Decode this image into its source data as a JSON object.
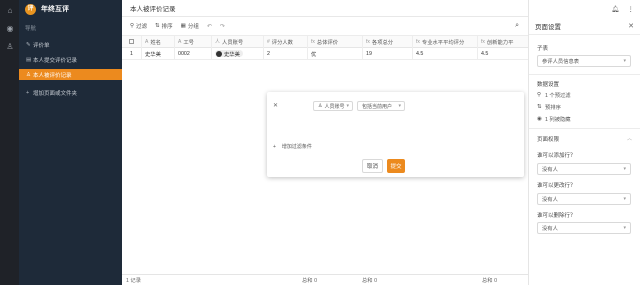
{
  "app": {
    "name": "年终互评",
    "logo_char": "评"
  },
  "rail": {
    "icons": [
      "home-icon",
      "eye-icon",
      "user-settings-icon"
    ]
  },
  "sidebar": {
    "section": "导航",
    "items": [
      {
        "label": "评价单",
        "icon": "edit-icon"
      },
      {
        "label": "本人提交评价记录",
        "icon": "list-icon"
      },
      {
        "label": "本人被评价记录",
        "icon": "user-icon",
        "active": true
      },
      {
        "label": "增加页面或文件夹",
        "icon": "plus-icon"
      }
    ]
  },
  "header": {
    "title": "本人被评价记录"
  },
  "toolbar": {
    "filter": "过滤",
    "sort": "排序",
    "group": "分组"
  },
  "table": {
    "columns": [
      "姓名",
      "工号",
      "人员账号",
      "评分人数",
      "总体评价",
      "各项总分",
      "专业水平平均评分",
      "创新能力平"
    ],
    "column_icons": [
      "A",
      "A",
      "人",
      "#",
      "fx",
      "fx",
      "fx",
      "fx"
    ],
    "rows": [
      {
        "index": "1",
        "name": "史华美",
        "id": "0002",
        "account": "史华美",
        "count": "2",
        "overall": "优",
        "total": "19",
        "pro": "4.5",
        "innov": "4.5"
      }
    ]
  },
  "footer": {
    "records": "1 记录",
    "sum_label_1": "总和 0",
    "sum_label_2": "总和 0",
    "sum_label_3": "总和 0"
  },
  "filter_popup": {
    "field": "人员账号",
    "operator": "包括当前用户",
    "add_condition": "增加过滤条件",
    "cancel": "取消",
    "submit": "提交"
  },
  "panel": {
    "title": "页面设置",
    "subtable_label": "子表",
    "subtable_value": "参评人员信息表",
    "data_settings": "数据设置",
    "filter_count": "1 个预过滤",
    "presort": "预排序",
    "hidden": "1 列被隐藏",
    "perm_title": "页面权限",
    "add_label": "谁可以添加行？",
    "add_value": "没有人",
    "edit_label": "谁可以更改行？",
    "edit_value": "没有人",
    "delete_label": "谁可以删除行？",
    "delete_value": "没有人"
  },
  "colors": {
    "sidebar": "#1e2a39",
    "rail": "#1f2228",
    "accent": "#ec8a1e"
  }
}
